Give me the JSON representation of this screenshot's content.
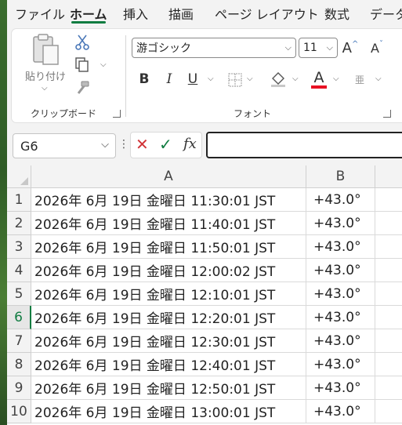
{
  "tabs": [
    "ファイル",
    "ホーム",
    "挿入",
    "描画",
    "ページ レイアウト",
    "数式",
    "データ"
  ],
  "active_tab_index": 1,
  "accent_color": "#107c41",
  "ribbon": {
    "clipboard": {
      "paste_label": "貼り付け",
      "group_label": "クリップボード",
      "icons": [
        "paste-icon",
        "cut-icon",
        "copy-icon",
        "format-painter-icon"
      ]
    },
    "font": {
      "group_label": "フォント",
      "font_name": "游ゴシック",
      "font_size": "11",
      "bold": "B",
      "italic": "I",
      "underline": "U",
      "font_color_letter": "A",
      "phonetic_label": "亜",
      "font_color": "#e81123",
      "icons": [
        "increase-font-icon",
        "decrease-font-icon",
        "borders-icon",
        "fill-color-icon",
        "font-color-icon",
        "phonetic-icon"
      ]
    }
  },
  "formula_bar": {
    "name_box": "G6",
    "cancel_icon": "✕",
    "enter_icon": "✓",
    "fx_label": "fx",
    "formula": ""
  },
  "grid": {
    "columns": [
      "A",
      "B"
    ],
    "selected_row": 6,
    "rows": [
      {
        "num": "1",
        "a": "2026年 6月 19日 金曜日 11:30:01 JST",
        "b": "+43.0°"
      },
      {
        "num": "2",
        "a": "2026年 6月 19日 金曜日 11:40:01 JST",
        "b": "+43.0°"
      },
      {
        "num": "3",
        "a": "2026年 6月 19日 金曜日 11:50:01 JST",
        "b": "+43.0°"
      },
      {
        "num": "4",
        "a": "2026年 6月 19日 金曜日 12:00:02 JST",
        "b": "+43.0°"
      },
      {
        "num": "5",
        "a": "2026年 6月 19日 金曜日 12:10:01 JST",
        "b": "+43.0°"
      },
      {
        "num": "6",
        "a": "2026年 6月 19日 金曜日 12:20:01 JST",
        "b": "+43.0°"
      },
      {
        "num": "7",
        "a": "2026年 6月 19日 金曜日 12:30:01 JST",
        "b": "+43.0°"
      },
      {
        "num": "8",
        "a": "2026年 6月 19日 金曜日 12:40:01 JST",
        "b": "+43.0°"
      },
      {
        "num": "9",
        "a": "2026年 6月 19日 金曜日 12:50:01 JST",
        "b": "+43.0°"
      },
      {
        "num": "10",
        "a": "2026年 6月 19日 金曜日 13:00:01 JST",
        "b": "+43.0°"
      }
    ]
  }
}
